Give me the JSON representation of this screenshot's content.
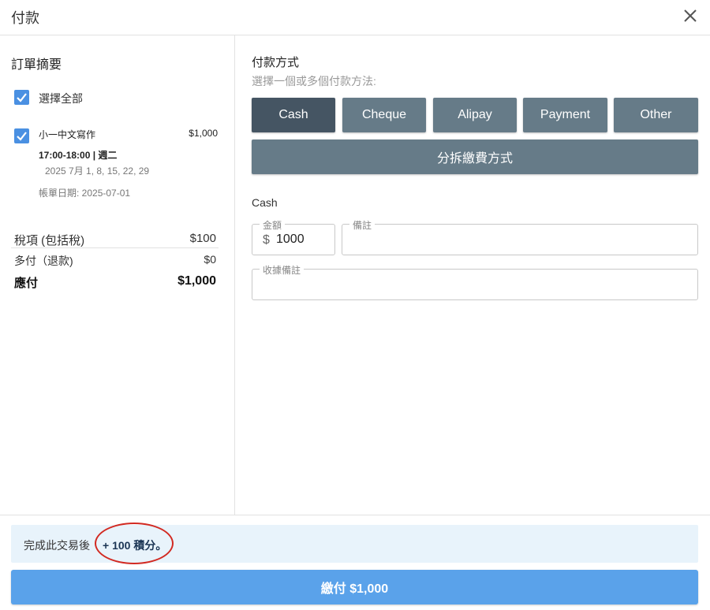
{
  "header": {
    "title": "付款"
  },
  "summary": {
    "title": "訂單摘要",
    "select_all": "選擇全部",
    "item": {
      "name": "小一中文寫作",
      "price": "$1,000",
      "time": "17:00-18:00 | 週二",
      "dates": "2025 7月 1, 8, 15, 22, 29",
      "billing_date": "帳單日期: 2025-07-01"
    },
    "totals": [
      {
        "label": "稅項 (包括稅)",
        "value": "$100"
      },
      {
        "label": "多付（退款)",
        "value": "$0"
      },
      {
        "label": "應付",
        "value": "$1,000"
      }
    ]
  },
  "payment": {
    "title": "付款方式",
    "subtitle": "選擇一個或多個付款方法:",
    "methods": [
      "Cash",
      "Cheque",
      "Alipay",
      "Payment",
      "Other"
    ],
    "split_label": "分拆繳費方式",
    "selected_method": "Cash",
    "amount_label": "金額",
    "currency_symbol": "$",
    "amount_value": "1000",
    "note_label": "備註",
    "receipt_note_label": "收據備註"
  },
  "footer": {
    "note_prefix": "完成此交易後",
    "points": "+ 100 積分。",
    "pay_label": "繳付 $1,000"
  },
  "colors": {
    "active_method": "#455563",
    "inactive_method": "#667b88",
    "pay_button": "#5aa2ea",
    "checkbox": "#4a90e2",
    "highlight_circle": "#d22a22"
  }
}
